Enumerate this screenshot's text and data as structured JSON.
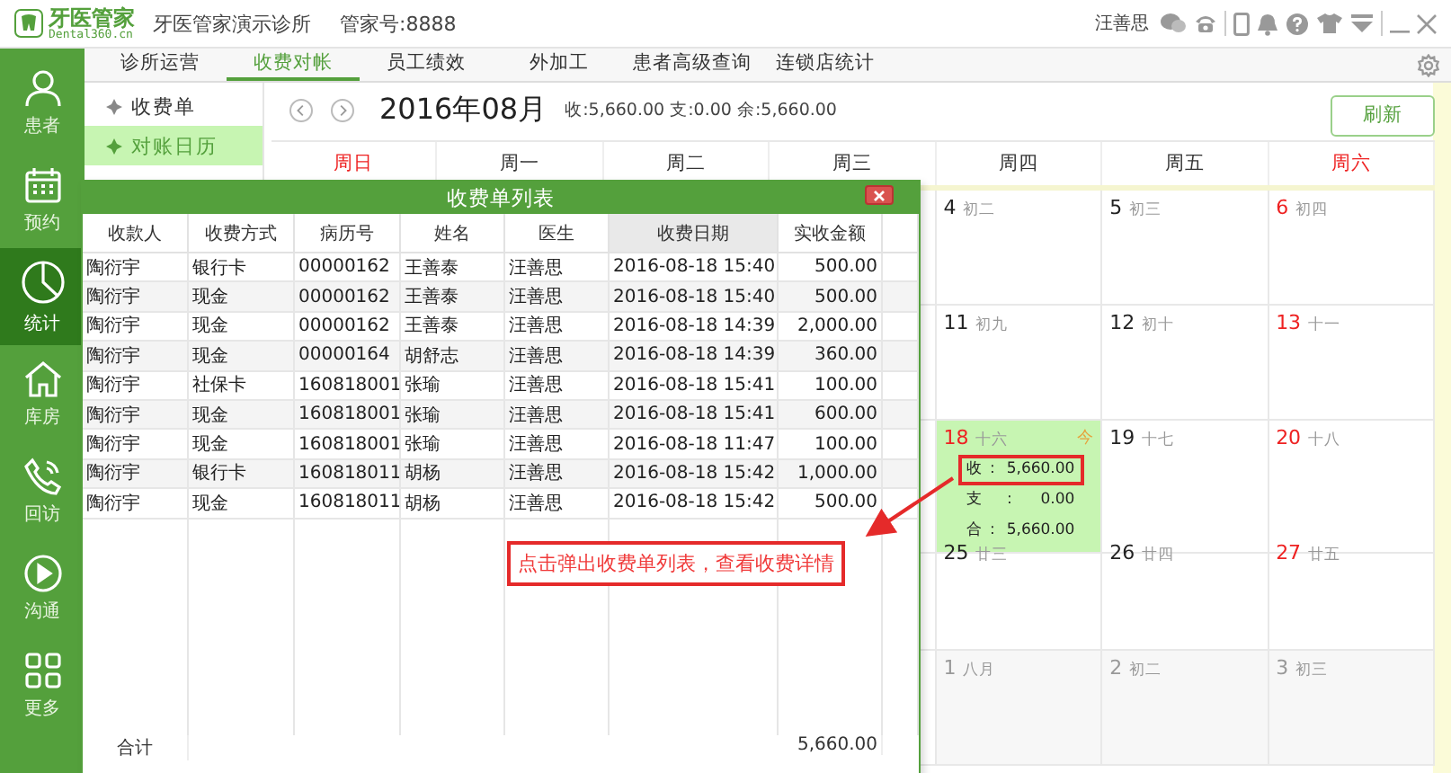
{
  "app": {
    "logo_name": "牙医管家",
    "logo_domain": "Dental360.cn",
    "clinic": "牙医管家演示诊所",
    "account": "管家号:8888",
    "user": "汪善思"
  },
  "sidebar": {
    "items": [
      {
        "label": "患者",
        "selected": false
      },
      {
        "label": "预约",
        "selected": false
      },
      {
        "label": "统计",
        "selected": true
      },
      {
        "label": "库房",
        "selected": false
      },
      {
        "label": "回访",
        "selected": false
      },
      {
        "label": "沟通",
        "selected": false
      },
      {
        "label": "更多",
        "selected": false
      }
    ]
  },
  "tabs": [
    {
      "label": "诊所运营",
      "selected": false
    },
    {
      "label": "收费对帐",
      "selected": true
    },
    {
      "label": "员工绩效",
      "selected": false
    },
    {
      "label": "外加工",
      "selected": false
    },
    {
      "label": "患者高级查询",
      "selected": false
    },
    {
      "label": "连锁店统计",
      "selected": false
    }
  ],
  "submenu": [
    {
      "label": "收费单",
      "selected": false
    },
    {
      "label": "对账日历",
      "selected": true
    }
  ],
  "calendar": {
    "month": "2016年08月",
    "summary": "收:5,660.00 支:0.00 余:5,660.00",
    "refresh": "刷新",
    "weekdays": [
      {
        "label": "周日",
        "weekend": true
      },
      {
        "label": "周一",
        "weekend": false
      },
      {
        "label": "周二",
        "weekend": false
      },
      {
        "label": "周三",
        "weekend": false
      },
      {
        "label": "周四",
        "weekend": false
      },
      {
        "label": "周五",
        "weekend": false
      },
      {
        "label": "周六",
        "weekend": true
      }
    ],
    "weeks": [
      {
        "cells": [
          {
            "day": "4",
            "lunar": "初二",
            "weekend": false,
            "today": false,
            "other_month": false
          },
          {
            "day": "5",
            "lunar": "初三",
            "weekend": false,
            "today": false,
            "other_month": false
          },
          {
            "day": "6",
            "lunar": "初四",
            "weekend": true,
            "today": false,
            "other_month": false
          }
        ]
      },
      {
        "cells": [
          {
            "day": "11",
            "lunar": "初九",
            "weekend": false,
            "today": false,
            "other_month": false
          },
          {
            "day": "12",
            "lunar": "初十",
            "weekend": false,
            "today": false,
            "other_month": false
          },
          {
            "day": "13",
            "lunar": "十一",
            "weekend": true,
            "today": false,
            "other_month": false
          }
        ]
      },
      {
        "cells": [
          {
            "day": "18",
            "lunar": "十六",
            "weekend": false,
            "today": true,
            "other_month": false,
            "today_mark": "今",
            "entries": [
              {
                "label": "收:",
                "value": "5,660.00",
                "highlighted": true
              },
              {
                "label": "支:",
                "value": "0.00",
                "highlighted": false
              },
              {
                "label": "合:",
                "value": "5,660.00",
                "highlighted": false
              }
            ]
          },
          {
            "day": "19",
            "lunar": "十七",
            "weekend": false,
            "today": false,
            "other_month": false
          },
          {
            "day": "20",
            "lunar": "十八",
            "weekend": true,
            "today": false,
            "other_month": false
          }
        ]
      },
      {
        "cells": [
          {
            "day": "25",
            "lunar": "廿三",
            "weekend": false,
            "today": false,
            "other_month": false
          },
          {
            "day": "26",
            "lunar": "廿四",
            "weekend": false,
            "today": false,
            "other_month": false
          },
          {
            "day": "27",
            "lunar": "廿五",
            "weekend": true,
            "today": false,
            "other_month": false
          }
        ]
      },
      {
        "cells": [
          {
            "day": "1",
            "lunar": "八月",
            "today": false,
            "other_month": true
          },
          {
            "day": "2",
            "lunar": "初二",
            "today": false,
            "other_month": true
          },
          {
            "day": "3",
            "lunar": "初三",
            "today": false,
            "other_month": true
          }
        ]
      }
    ]
  },
  "dialog": {
    "title": "收费单列表",
    "columns": [
      {
        "label": "收款人",
        "sorted": false
      },
      {
        "label": "收费方式",
        "sorted": false
      },
      {
        "label": "病历号",
        "sorted": false
      },
      {
        "label": "姓名",
        "sorted": false
      },
      {
        "label": "医生",
        "sorted": false
      },
      {
        "label": "收费日期",
        "sorted": true
      },
      {
        "label": "实收金额",
        "sorted": false
      }
    ],
    "rows": [
      [
        "陶衍宇",
        "银行卡",
        "00000162",
        "王善泰",
        "汪善思",
        "2016-08-18 15:40",
        "500.00"
      ],
      [
        "陶衍宇",
        "现金",
        "00000162",
        "王善泰",
        "汪善思",
        "2016-08-18 15:40",
        "500.00"
      ],
      [
        "陶衍宇",
        "现金",
        "00000162",
        "王善泰",
        "汪善思",
        "2016-08-18 14:39",
        "2,000.00"
      ],
      [
        "陶衍宇",
        "现金",
        "00000164",
        "胡舒志",
        "汪善思",
        "2016-08-18 14:39",
        "360.00"
      ],
      [
        "陶衍宇",
        "社保卡",
        "160818001",
        "张瑜",
        "汪善思",
        "2016-08-18 15:41",
        "100.00"
      ],
      [
        "陶衍宇",
        "现金",
        "160818001",
        "张瑜",
        "汪善思",
        "2016-08-18 15:41",
        "600.00"
      ],
      [
        "陶衍宇",
        "现金",
        "160818001",
        "张瑜",
        "汪善思",
        "2016-08-18 11:47",
        "100.00"
      ],
      [
        "陶衍宇",
        "银行卡",
        "160818011",
        "胡杨",
        "汪善思",
        "2016-08-18 15:42",
        "1,000.00"
      ],
      [
        "陶衍宇",
        "现金",
        "160818011",
        "胡杨",
        "汪善思",
        "2016-08-18 15:42",
        "500.00"
      ]
    ],
    "total_label": "合计",
    "total": "5,660.00"
  },
  "annotation": {
    "text": "点击弹出收费单列表，查看收费详情"
  }
}
